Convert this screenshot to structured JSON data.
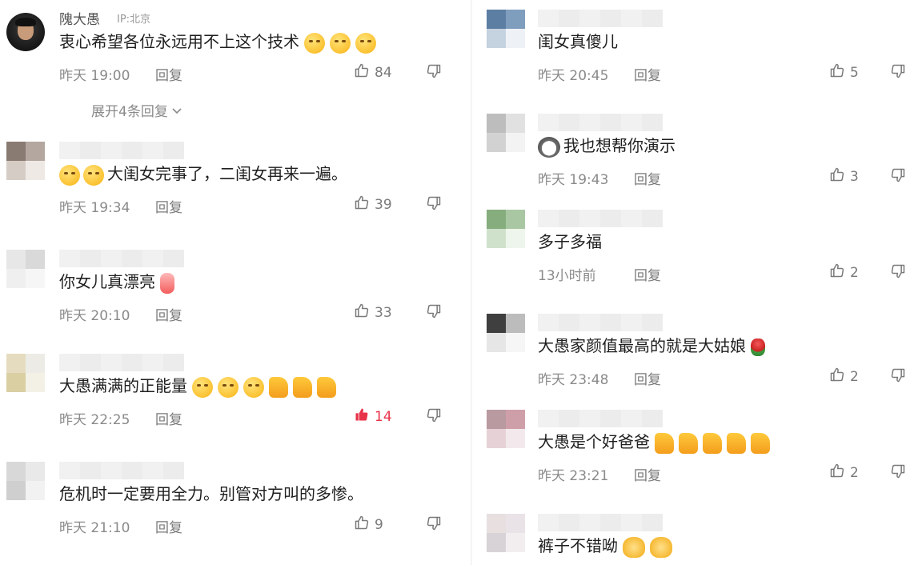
{
  "left": [
    {
      "user": "隗大愚",
      "ip": "IP:北京",
      "text": "衷心希望各位永远用不上这个技术",
      "emoji": [
        "face",
        "face",
        "face"
      ],
      "time": "昨天 19:00",
      "reply": "回复",
      "likes": "84",
      "liked": false,
      "expand": "展开4条回复"
    },
    {
      "text": "大闺女完事了，二闺女再来一遍。",
      "emoji_before": [
        "face",
        "face"
      ],
      "time": "昨天 19:34",
      "reply": "回复",
      "likes": "39",
      "liked": false
    },
    {
      "text": "你女儿真漂亮",
      "emoji": [
        "heart"
      ],
      "time": "昨天 20:10",
      "reply": "回复",
      "likes": "33",
      "liked": false
    },
    {
      "text": "大愚满满的正能量",
      "emoji": [
        "face",
        "face",
        "face",
        "thumb",
        "thumb",
        "thumb"
      ],
      "time": "昨天 22:25",
      "reply": "回复",
      "likes": "14",
      "liked": true
    },
    {
      "text": "危机时一定要用全力。别管对方叫的多惨。",
      "emoji": [],
      "time": "昨天 21:10",
      "reply": "回复",
      "likes": "9",
      "liked": false
    }
  ],
  "right": [
    {
      "text": "闺女真傻儿",
      "emoji": [],
      "time": "昨天 20:45",
      "reply": "回复",
      "likes": "5",
      "liked": false
    },
    {
      "text": "我也想帮你演示",
      "emoji_before": [
        "cat"
      ],
      "time": "昨天 19:43",
      "reply": "回复",
      "likes": "3",
      "liked": false
    },
    {
      "text": "多子多福",
      "emoji": [],
      "time": "13小时前",
      "reply": "回复",
      "likes": "2",
      "liked": false
    },
    {
      "text": "大愚家颜值最高的就是大姑娘",
      "emoji": [
        "rose"
      ],
      "time": "昨天 23:48",
      "reply": "回复",
      "likes": "2",
      "liked": false
    },
    {
      "text": "大愚是个好爸爸",
      "emoji": [
        "thumb",
        "thumb",
        "thumb",
        "thumb",
        "thumb"
      ],
      "time": "昨天 23:21",
      "reply": "回复",
      "likes": "2",
      "liked": false
    },
    {
      "text": "裤子不错呦",
      "emoji": [
        "clap",
        "clap"
      ],
      "time": "",
      "reply": "",
      "likes": "",
      "liked": false
    }
  ]
}
